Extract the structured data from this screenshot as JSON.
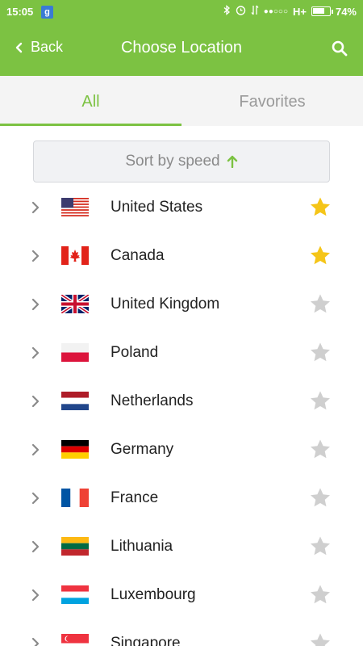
{
  "status": {
    "time": "15:05",
    "network": "H+",
    "battery": "74%",
    "battery_level": 0.74,
    "app_icon": "g"
  },
  "header": {
    "back_label": "Back",
    "title": "Choose Location"
  },
  "tabs": [
    {
      "label": "All",
      "active": true
    },
    {
      "label": "Favorites",
      "active": false
    }
  ],
  "sort": {
    "label": "Sort by speed"
  },
  "colors": {
    "brand_green": "#7cc242",
    "star_active": "#f5c518",
    "star_inactive": "#cfcfcf"
  },
  "countries": [
    {
      "name": "United States",
      "flag": "us-flag",
      "favorite": true
    },
    {
      "name": "Canada",
      "flag": "ca-flag",
      "favorite": true
    },
    {
      "name": "United Kingdom",
      "flag": "gb-flag",
      "favorite": false
    },
    {
      "name": "Poland",
      "flag": "pl-flag",
      "favorite": false
    },
    {
      "name": "Netherlands",
      "flag": "nl-flag",
      "favorite": false
    },
    {
      "name": "Germany",
      "flag": "de-flag",
      "favorite": false
    },
    {
      "name": "France",
      "flag": "fr-flag",
      "favorite": false
    },
    {
      "name": "Lithuania",
      "flag": "lt-flag",
      "favorite": false
    },
    {
      "name": "Luxembourg",
      "flag": "lu-flag",
      "favorite": false
    },
    {
      "name": "Singapore",
      "flag": "sg-flag",
      "favorite": false
    }
  ]
}
